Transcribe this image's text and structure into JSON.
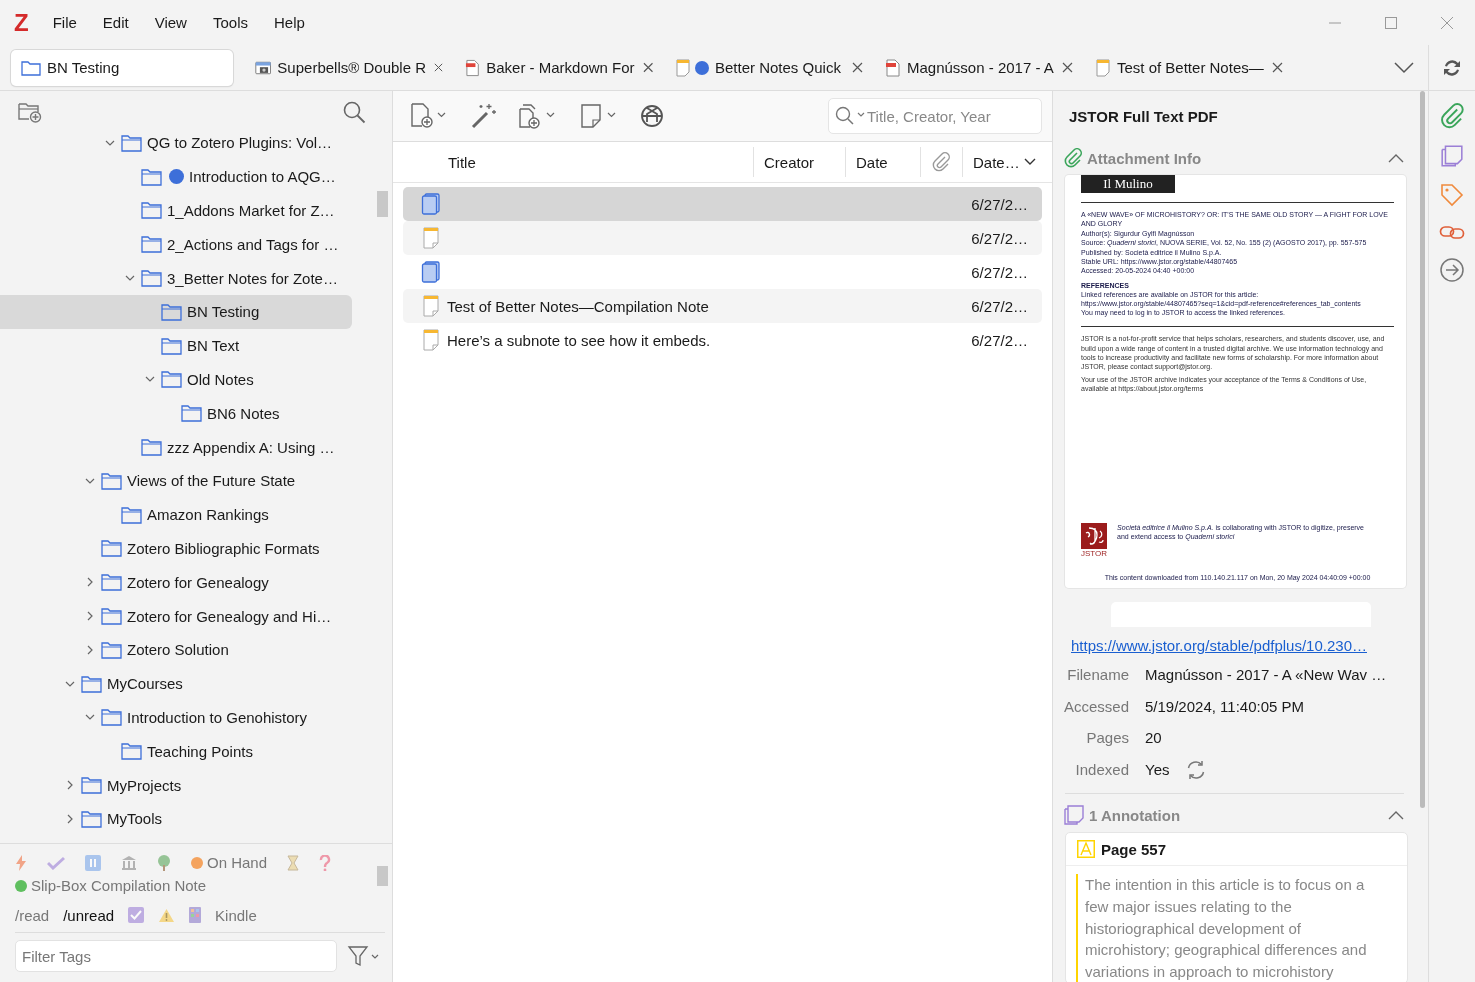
{
  "app": {
    "logo": "Z",
    "menu": [
      "File",
      "Edit",
      "View",
      "Tools",
      "Help"
    ]
  },
  "tabs": [
    {
      "kind": "library",
      "label": "BN Testing",
      "selected": true
    },
    {
      "kind": "webpage",
      "label": "Superbells® Double R",
      "selected": false
    },
    {
      "kind": "pdf",
      "label": "Baker - Markdown For",
      "selected": false
    },
    {
      "kind": "note",
      "label": "Better Notes Quick",
      "color": "#3d6fd9",
      "selected": false
    },
    {
      "kind": "pdf",
      "label": "Magnússon - 2017 - A",
      "selected": false
    },
    {
      "kind": "note",
      "label": "Test of Better Notes—",
      "selected": false
    }
  ],
  "collections": [
    {
      "children": [
        {
          "children": [
            {
              "label": "QG to Zotero Plugins: Vol…",
              "expanded": true,
              "selected": false,
              "children": [
                {
                  "label": "Introduction to AQG…",
                  "color": "#3d6fd9",
                  "selected": false
                },
                {
                  "label": "1_Addons Market for Z…",
                  "selected": false
                },
                {
                  "label": "2_Actions and Tags for …",
                  "selected": false
                },
                {
                  "label": "3_Better Notes for Zote…",
                  "expanded": true,
                  "selected": false,
                  "children": [
                    {
                      "label": "BN Testing",
                      "selected": true
                    },
                    {
                      "label": "BN Text",
                      "selected": false
                    },
                    {
                      "label": "Old Notes",
                      "expanded": true,
                      "selected": false,
                      "children": [
                        {
                          "label": "BN6 Notes",
                          "selected": false
                        }
                      ]
                    }
                  ]
                },
                {
                  "label": "zzz Appendix A: Using …",
                  "selected": false
                }
              ]
            }
          ]
        },
        {
          "label": "Views of the Future State",
          "expanded": true,
          "selected": false,
          "children": [
            {
              "label": "Amazon Rankings",
              "selected": false
            }
          ]
        },
        {
          "label": "Zotero Bibliographic Formats",
          "selected": false
        },
        {
          "label": "Zotero for Genealogy",
          "expanded": false,
          "selected": false
        },
        {
          "label": "Zotero for Genealogy and Hi…",
          "expanded": false,
          "selected": false
        },
        {
          "label": "Zotero Solution",
          "expanded": false,
          "selected": false
        }
      ]
    },
    {
      "label": "MyCourses",
      "expanded": true,
      "selected": false,
      "children": [
        {
          "label": "Introduction to Genohistory",
          "expanded": true,
          "selected": false,
          "children": [
            {
              "label": "Teaching Points",
              "selected": false
            }
          ]
        }
      ]
    },
    {
      "label": "MyProjects",
      "expanded": false,
      "selected": false
    },
    {
      "label": "MyTools",
      "expanded": false,
      "selected": false
    }
  ],
  "tags": {
    "colored": [
      {
        "kind": "icon",
        "disabled": true
      },
      {
        "kind": "icon",
        "disabled": true
      },
      {
        "kind": "icon",
        "disabled": true
      },
      {
        "kind": "icon",
        "disabled": true
      },
      {
        "kind": "icon",
        "disabled": true
      },
      {
        "kind": "label",
        "label": "On Hand",
        "color": "#f4a35e",
        "disabled": true
      },
      {
        "kind": "icon",
        "disabled": true
      },
      {
        "kind": "icon",
        "disabled": true
      },
      {
        "kind": "label",
        "label": "Slip-Box Compilation Note",
        "color": "#5fbf5f",
        "disabled": true
      }
    ],
    "plain": [
      {
        "kind": "label",
        "label": "/read",
        "disabled": true
      },
      {
        "kind": "label",
        "label": "/unread",
        "disabled": false
      },
      {
        "kind": "icon",
        "disabled": true
      },
      {
        "kind": "icon",
        "disabled": true
      },
      {
        "kind": "icon",
        "disabled": true
      },
      {
        "kind": "label",
        "label": "Kindle",
        "disabled": true
      }
    ],
    "filter": {
      "placeholder": "Filter Tags"
    }
  },
  "items": {
    "search": {
      "placeholder": "Title, Creator, Year"
    },
    "columns": [
      {
        "kind": "text",
        "label": "Title",
        "sorted": false
      },
      {
        "kind": "text",
        "label": "Creator",
        "sorted": false
      },
      {
        "kind": "text",
        "label": "Date",
        "sorted": false
      },
      {
        "kind": "attachments",
        "sorted": false
      },
      {
        "kind": "text",
        "label": "Date…",
        "sorted": true
      }
    ],
    "rows": [
      {
        "kind": "attachment",
        "date": "6/27/2…",
        "selected": true
      },
      {
        "kind": "note",
        "date": "6/27/2…",
        "selected": false
      },
      {
        "kind": "attachment",
        "date": "6/27/2…",
        "selected": false
      },
      {
        "kind": "note",
        "title": "Test of Better Notes—Compilation Note",
        "date": "6/27/2…",
        "selected": false
      },
      {
        "kind": "note",
        "title": "Here’s a subnote to see how it embeds.",
        "date": "6/27/2…",
        "selected": false
      }
    ]
  },
  "item_pane": {
    "title": "JSTOR Full Text PDF",
    "attachment_info": {
      "heading": "Attachment Info",
      "expanded": true,
      "document": {
        "logo": "Il Mulino",
        "title": "A «NEW WAVE» OF MICROHISTORY? OR: IT'S THE SAME OLD STORY — A FIGHT FOR LOVE AND GLORY",
        "meta": [
          "Author(s): Sigurdur Gylfi Magnússon",
          "Source: *Quaderni storici*, NUOVA SERIE, Vol. 52, No. 155 (2) (AGOSTO 2017), pp. 557-575",
          "Published by: Società editrice il Mulino S.p.A.",
          "Stable URL: https://www.jstor.org/stable/44807465",
          "Accessed: 20-05-2024 04:40 +00:00"
        ],
        "references_heading": "REFERENCES",
        "references": [
          "Linked references are available on JSTOR for this article:",
          "https://www.jstor.org/stable/44807465?seq=1&cid=pdf-reference#references_tab_contents",
          "You may need to log in to JSTOR to access the linked references."
        ],
        "notice": [
          "JSTOR is a not-for-profit service that helps scholars, researchers, and students discover, use, and build upon a wide range of content in a trusted digital archive. We use information technology and tools to increase productivity and facilitate new forms of scholarship. For more information about JSTOR, please contact support@jstor.org.",
          "Your use of the JSTOR archive indicates your acceptance of the Terms & Conditions of Use, available at https://about.jstor.org/terms"
        ],
        "publisher_note": "*Società editrice il Mulino S.p.A.* is collaborating with JSTOR to digitize, preserve and extend access to *Quaderni storici*",
        "jstor_logo": "JSTOR",
        "footer": "This content downloaded from 110.140.21.117 on Mon, 20 May 2024 04:40:09 +00:00"
      },
      "url": "https://www.jstor.org/stable/pdfplus/10.230…",
      "fields": [
        {
          "kind": "text",
          "label": "Filename",
          "value": "Magnússon - 2017 - A «New Wav …"
        },
        {
          "kind": "text",
          "label": "Accessed",
          "value": "5/19/2024, 11:40:05 PM"
        },
        {
          "kind": "text",
          "label": "Pages",
          "value": "20"
        },
        {
          "kind": "indexed",
          "label": "Indexed",
          "value": "Yes"
        }
      ]
    },
    "annotations": {
      "heading": "1 Annotation",
      "expanded": true,
      "items": [
        {
          "page": "Page 557",
          "color": "#ffd400",
          "text": "The intention in this article is to focus on a few major issues relating to the historiographical development of microhistory; geographical differences and variations in approach to microhistory"
        }
      ]
    }
  }
}
